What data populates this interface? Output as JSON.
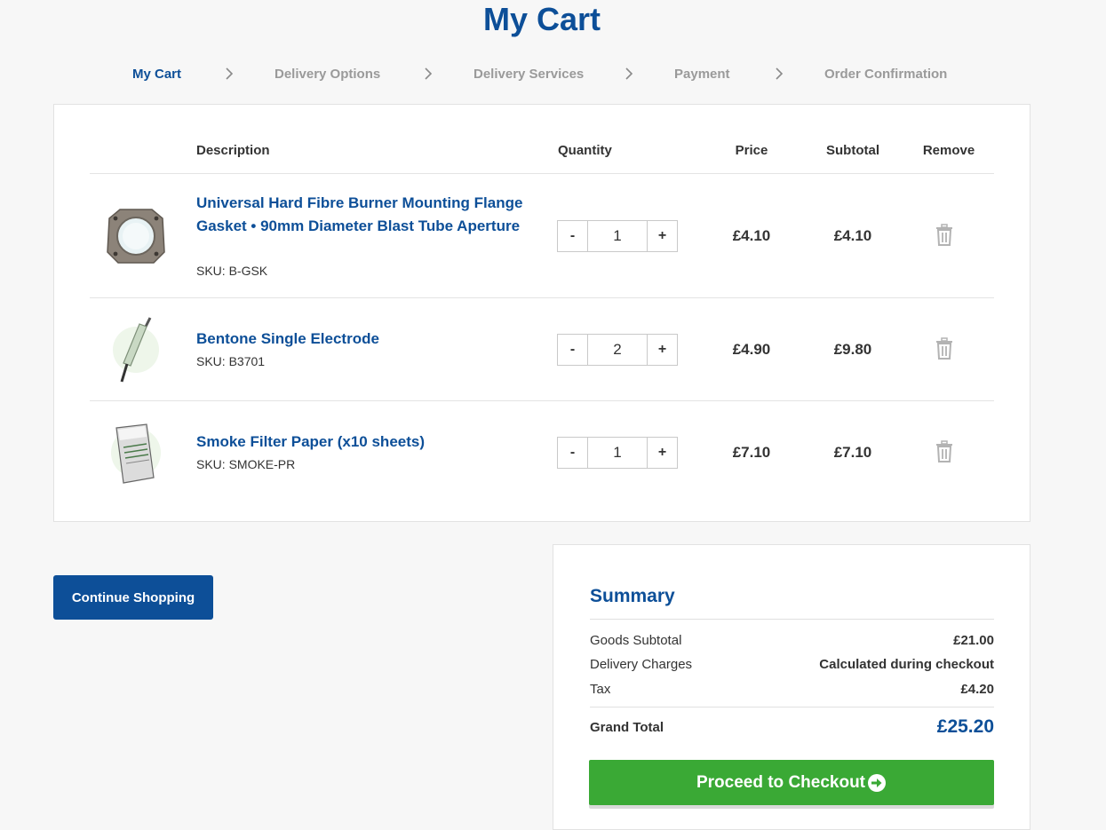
{
  "page": {
    "title": "My Cart"
  },
  "steps": [
    {
      "label": "My Cart"
    },
    {
      "label": "Delivery Options"
    },
    {
      "label": "Delivery Services"
    },
    {
      "label": "Payment"
    },
    {
      "label": "Order Confirmation"
    }
  ],
  "cart": {
    "headers": {
      "description": "Description",
      "quantity": "Quantity",
      "price": "Price",
      "subtotal": "Subtotal",
      "remove": "Remove"
    },
    "items": [
      {
        "name": "Universal Hard Fibre Burner Mounting Flange Gasket • 90mm Diameter Blast Tube Aperture",
        "sku": "SKU: B-GSK",
        "qty": "1",
        "price": "£4.10",
        "subtotal": "£4.10"
      },
      {
        "name": "Bentone Single Electrode",
        "sku": "SKU: B3701",
        "qty": "2",
        "price": "£4.90",
        "subtotal": "£9.80"
      },
      {
        "name": "Smoke Filter Paper (x10 sheets)",
        "sku": "SKU: SMOKE-PR",
        "qty": "1",
        "price": "£7.10",
        "subtotal": "£7.10"
      }
    ],
    "minus_label": "-",
    "plus_label": "+"
  },
  "actions": {
    "continue_label": "Continue Shopping",
    "checkout_label": "Proceed to Checkout"
  },
  "summary": {
    "title": "Summary",
    "goods_label": "Goods Subtotal",
    "goods_value": "£21.00",
    "delivery_label": "Delivery Charges",
    "delivery_value": "Calculated during checkout",
    "tax_label": "Tax",
    "tax_value": "£4.20",
    "grand_label": "Grand Total",
    "grand_value": "£25.20"
  },
  "colors": {
    "brand": "#0d4f98",
    "checkout": "#3aa935",
    "muted": "#9a9a9a"
  },
  "icons": {
    "step_separator": "chevron-right-icon",
    "remove": "trash-icon",
    "checkout": "arrow-circle-right-icon"
  }
}
